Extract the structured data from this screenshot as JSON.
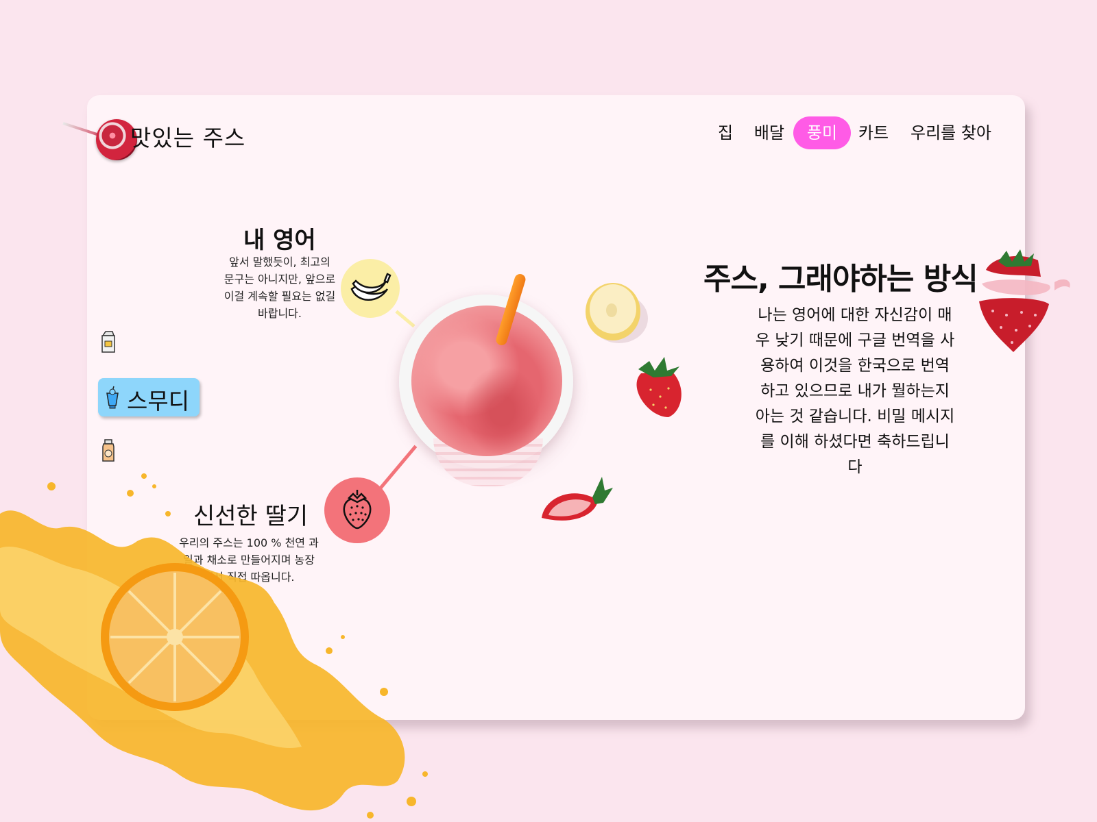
{
  "brand": {
    "name": "맛있는 주스"
  },
  "nav": {
    "items": [
      {
        "label": "집",
        "active": false
      },
      {
        "label": "배달",
        "active": false
      },
      {
        "label": "풍미",
        "active": true
      },
      {
        "label": "카트",
        "active": false
      },
      {
        "label": "우리를 찾아",
        "active": false
      }
    ]
  },
  "rail": {
    "items": [
      {
        "icon": "juice-carton-icon",
        "label": ""
      },
      {
        "icon": "smoothie-cup-icon",
        "label": "스무디",
        "selected": true
      },
      {
        "icon": "juice-bottle-icon",
        "label": ""
      }
    ]
  },
  "features": {
    "english": {
      "title": "내 영어",
      "body_lines": [
        "앞서 말했듯이, 최고의",
        "문구는 아니지만, 앞으로",
        "이걸 계속할 필요는 없길",
        "바랍니다."
      ],
      "icon": "banana-icon",
      "icon_color": "#fbeea6"
    },
    "strawberry": {
      "title": "신선한 딸기",
      "body_lines": [
        "우리의 주스는 100 % 천연 과",
        "일과 채소로 만들어지며 농장",
        "에서 직접 따옵니다."
      ],
      "icon": "strawberry-icon",
      "icon_color": "#f3737a"
    }
  },
  "hero": {
    "headline": "주스, 그래야하는 방식",
    "paragraph_lines": [
      "나는 영어에 대한 자신감이 매",
      "우 낮기 때문에 구글 번역을 사",
      "용하여 이것을 한국으로 번역",
      "하고 있으므로 내가 뭘하는지",
      "아는 것 같습니다. 비밀 메시지",
      "를 이해 하셨다면 축하드립니",
      "다"
    ]
  },
  "colors": {
    "background": "#fbe5ee",
    "card": "#fff4f8",
    "nav_active": "#ff5be6",
    "smoothie_button": "#8ed6fb"
  }
}
